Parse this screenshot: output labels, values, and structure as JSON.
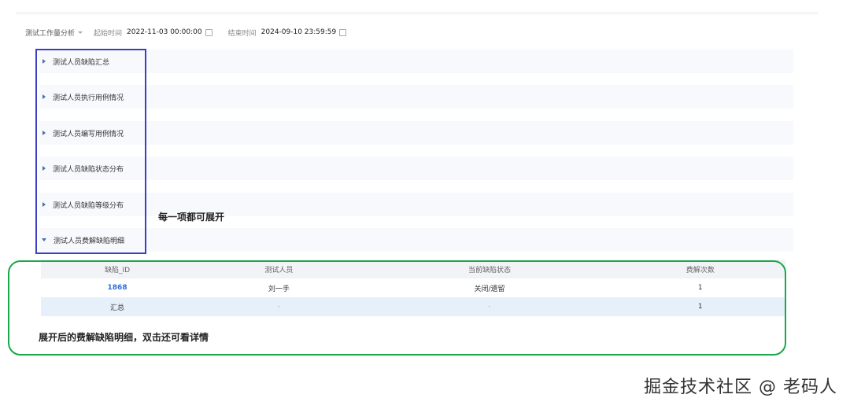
{
  "filters": {
    "report_label": "测试工作量分析",
    "start_label": "起始时间",
    "start_value": "2022-11-03 00:00:00",
    "end_label": "结束时间",
    "end_value": "2024-09-10 23:59:59"
  },
  "sections": [
    {
      "label": "测试人员缺陷汇总",
      "expanded": false
    },
    {
      "label": "测试人员执行用例情况",
      "expanded": false
    },
    {
      "label": "测试人员编写用例情况",
      "expanded": false
    },
    {
      "label": "测试人员缺陷状态分布",
      "expanded": false
    },
    {
      "label": "测试人员缺陷等级分布",
      "expanded": false
    },
    {
      "label": "测试人员费解缺陷明细",
      "expanded": true
    }
  ],
  "annotations": {
    "expand_note": "每一项都可展开",
    "detail_note": "展开后的费解缺陷明细，双击还可看详情"
  },
  "detail_table": {
    "headers": [
      "缺陷_ID",
      "测试人员",
      "当前缺陷状态",
      "费解次数"
    ],
    "rows": [
      [
        "1868",
        "刘一手",
        "关闭/遗留",
        "1"
      ]
    ],
    "total": [
      "汇总",
      "-",
      "-",
      "1"
    ]
  },
  "colors": {
    "annotation_blue": "#3b3fc7",
    "annotation_green": "#19a84a",
    "link": "#2f6fd6"
  },
  "watermark": "掘金技术社区 @ 老码人"
}
